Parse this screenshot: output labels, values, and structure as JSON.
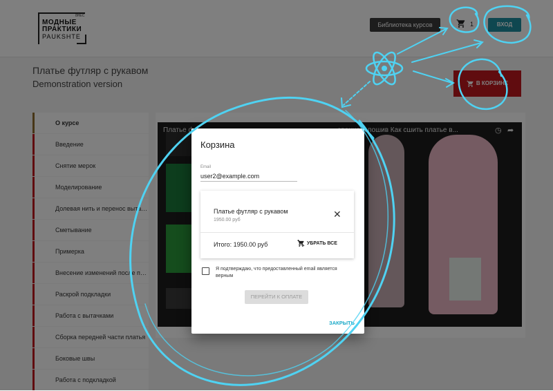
{
  "header": {
    "logo_line1": "МОДНЫЕ",
    "logo_line2": "ПРАКТИКИ",
    "logo_line3": "PAUKSHTE",
    "logo_sup": "8НЕС",
    "library_label": "Библиотека курсов",
    "cart_count": "1",
    "login_label": "ВХОД"
  },
  "course": {
    "title": "Платье футляр с рукавом",
    "subtitle": "Demonstration version",
    "in_cart_label": "В КОРЗИНЕ"
  },
  "sidebar": {
    "items": [
      "О курсе",
      "Введение",
      "Снятие мерок",
      "Моделирование",
      "Долевая нить и перенос вытачек",
      "Сметывание",
      "Примерка",
      "Внесение изменений после при...",
      "Раскрой подкладки",
      "Работа с вытачками",
      "Сборка передней части платья",
      "Боковые швы",
      "Работа с подкладкой"
    ]
  },
  "video": {
    "title_left": "Платье ф",
    "title_right": "ование и пошив Как сшить платье в..."
  },
  "modal": {
    "title": "Корзина",
    "email_label": "Email",
    "email_value": "user2@example.com",
    "item_name": "Платье футляр с рукавом",
    "item_price": "1950.00 руб",
    "total": "Итого: 1950.00 руб",
    "clear_all_label": "УБРАТЬ ВСЕ",
    "confirm_text": "Я подтверждаю, что предоставленный email является верным",
    "pay_label": "ПЕРЕЙТИ К ОПЛАТЕ",
    "close_label": "ЗАКРЫТЬ"
  },
  "colors": {
    "accent_teal": "#1f8fa0",
    "brand_red": "#c0191f",
    "link_blue": "#1aa9c8",
    "annotation_cyan": "#4fd2f2"
  }
}
